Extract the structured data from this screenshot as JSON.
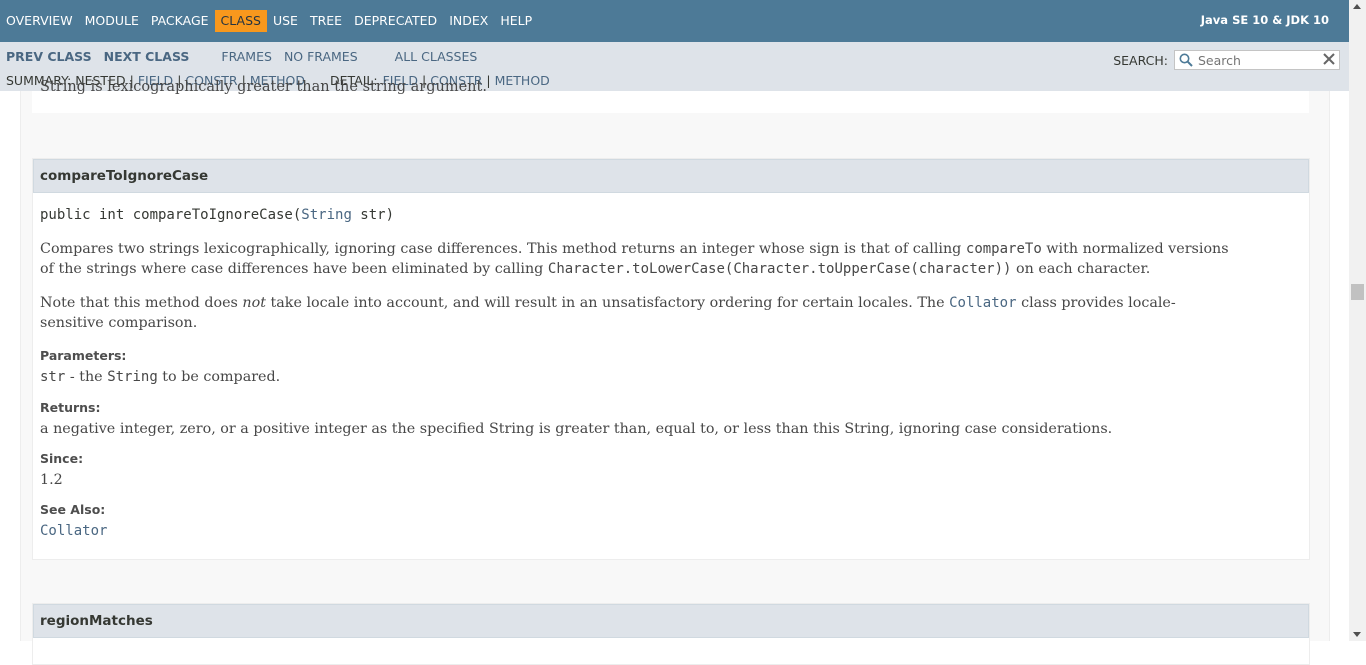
{
  "topnav": {
    "items": [
      "OVERVIEW",
      "MODULE",
      "PACKAGE",
      "CLASS",
      "USE",
      "TREE",
      "DEPRECATED",
      "INDEX",
      "HELP"
    ],
    "active": "CLASS",
    "about": "Java SE 10 & JDK 10"
  },
  "subnav": {
    "prev_class": "PREV CLASS",
    "next_class": "NEXT CLASS",
    "frames": "FRAMES",
    "no_frames": "NO FRAMES",
    "all_classes": "ALL CLASSES",
    "summary_label": "SUMMARY: NESTED",
    "summary_field": "FIELD",
    "summary_constr": "CONSTR",
    "summary_method": "METHOD",
    "detail_label": "DETAIL:",
    "detail_field": "FIELD",
    "detail_constr": "CONSTR",
    "detail_method": "METHOD",
    "separator": "|",
    "search_label": "SEARCH:",
    "search_placeholder": "Search"
  },
  "previous_method_tail": "String is lexicographically greater than the string argument.",
  "method1": {
    "title": "compareToIgnoreCase",
    "sig_prefix": "public int compareToIgnoreCase(",
    "sig_type": "String",
    "sig_suffix": " str)",
    "desc1_a": "Compares two strings lexicographically, ignoring case differences. This method returns an integer whose sign is that of calling ",
    "desc1_code1": "compareTo",
    "desc1_b": " with normalized versions of the strings where case differences have been eliminated by calling ",
    "desc1_code2": "Character.toLowerCase(Character.toUpperCase(character))",
    "desc1_c": " on each character.",
    "desc2_a": "Note that this method does ",
    "desc2_em": "not",
    "desc2_b": " take locale into account, and will result in an unsatisfactory ordering for certain locales. The ",
    "desc2_link": "Collator",
    "desc2_c": " class provides locale-sensitive comparison.",
    "params_label": "Parameters:",
    "param_name": "str",
    "param_mid": " - the ",
    "param_type": "String",
    "param_end": " to be compared.",
    "returns_label": "Returns:",
    "returns_text": "a negative integer, zero, or a positive integer as the specified String is greater than, equal to, or less than this String, ignoring case considerations.",
    "since_label": "Since:",
    "since_value": "1.2",
    "see_also_label": "See Also:",
    "see_also_link": "Collator"
  },
  "method2": {
    "title": "regionMatches"
  },
  "icons": {
    "search": "magnifier-icon",
    "clear": "close-x-icon"
  },
  "colors": {
    "topnav_bg": "#4d7a97",
    "active_tab": "#f8981d",
    "subnav_bg": "#dee3e9",
    "link": "#4a6782"
  }
}
